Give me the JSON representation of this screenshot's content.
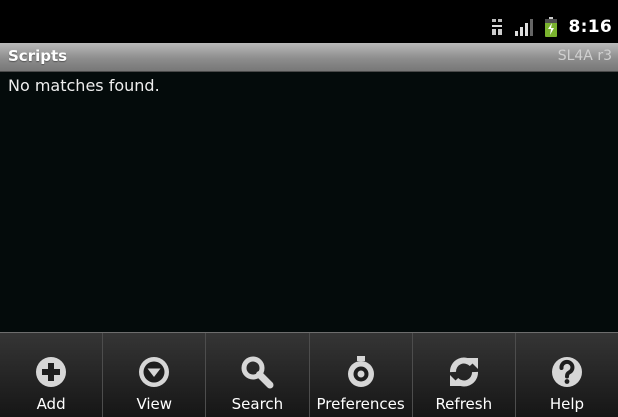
{
  "status_bar": {
    "time": "8:16"
  },
  "header": {
    "title": "Scripts",
    "subtitle": "SL4A r3"
  },
  "content": {
    "empty_message": "No matches found."
  },
  "menu": {
    "items": [
      {
        "label": "Add",
        "icon": "add-icon"
      },
      {
        "label": "View",
        "icon": "view-icon"
      },
      {
        "label": "Search",
        "icon": "search-icon"
      },
      {
        "label": "Preferences",
        "icon": "preferences-icon"
      },
      {
        "label": "Refresh",
        "icon": "refresh-icon"
      },
      {
        "label": "Help",
        "icon": "help-icon"
      }
    ]
  }
}
